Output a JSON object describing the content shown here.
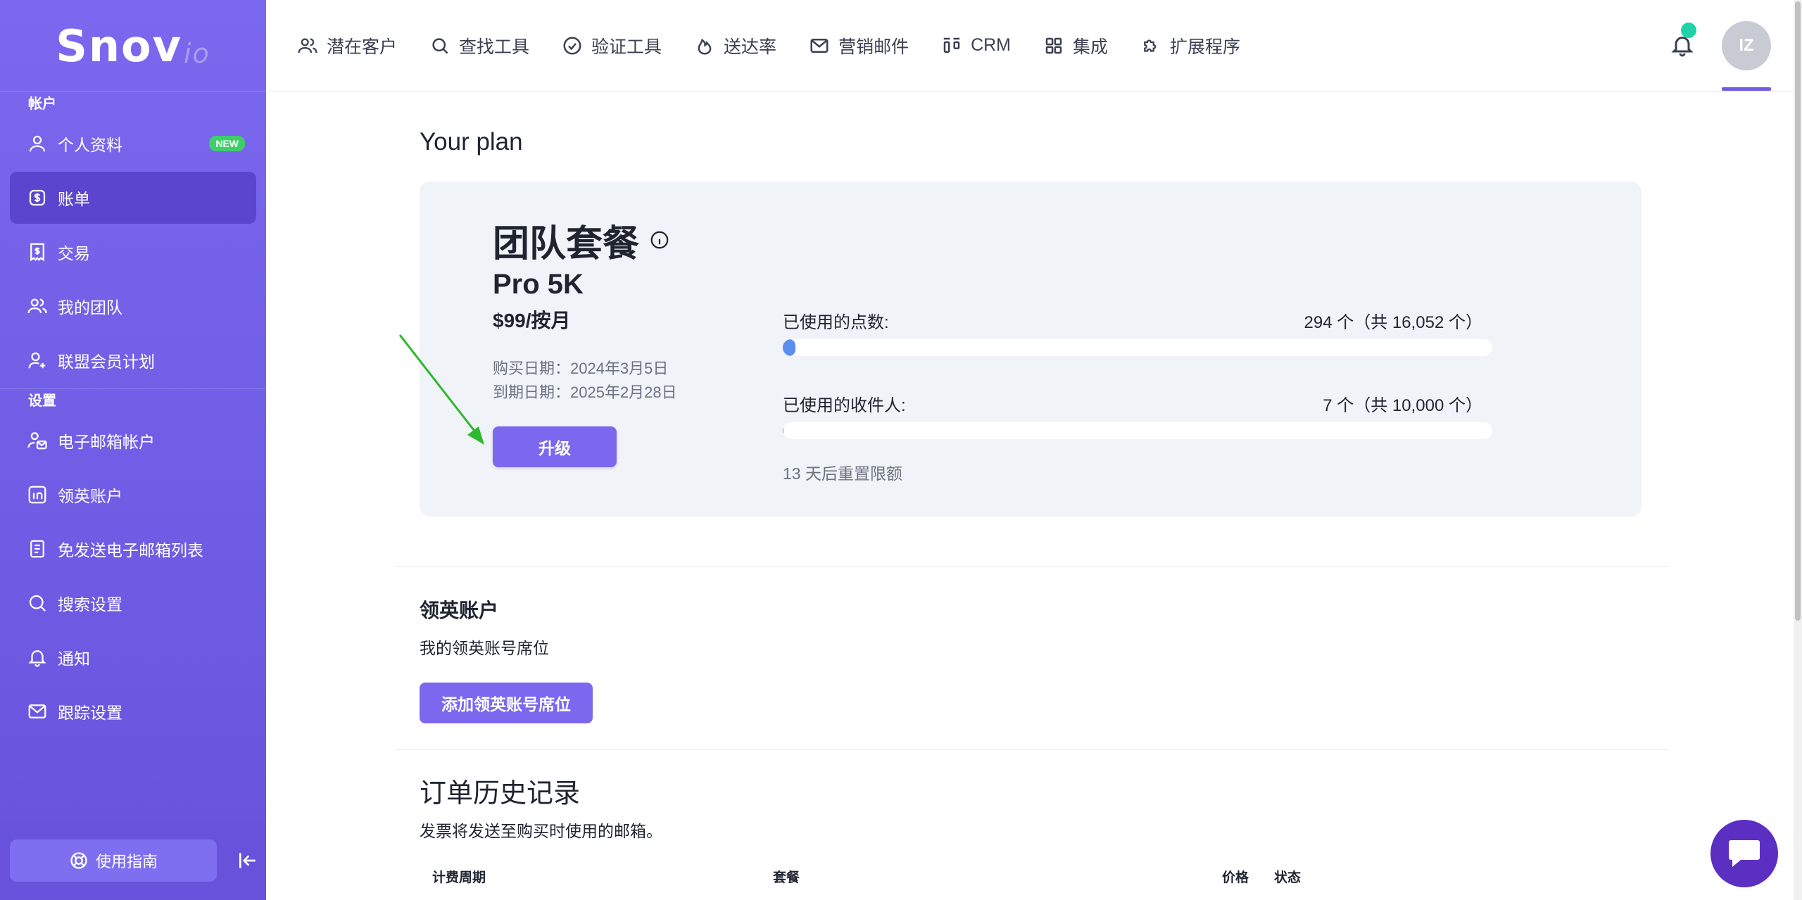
{
  "logo": {
    "main": "Snov",
    "suffix": "io"
  },
  "sidebar": {
    "section_account": "帐户",
    "section_settings": "设置",
    "items": [
      {
        "label": "个人资料",
        "badge": "NEW"
      },
      {
        "label": "账单"
      },
      {
        "label": "交易"
      },
      {
        "label": "我的团队"
      },
      {
        "label": "联盟会员计划"
      },
      {
        "label": "电子邮箱帐户"
      },
      {
        "label": "领英账户"
      },
      {
        "label": "免发送电子邮箱列表"
      },
      {
        "label": "搜索设置"
      },
      {
        "label": "通知"
      },
      {
        "label": "跟踪设置"
      }
    ],
    "guide_label": "使用指南"
  },
  "topnav": {
    "items": [
      "潜在客户",
      "查找工具",
      "验证工具",
      "送达率",
      "营销邮件",
      "CRM",
      "集成",
      "扩展程序"
    ],
    "avatar_initials": "IZ"
  },
  "plan": {
    "page_title": "Your plan",
    "name": "团队套餐",
    "tier": "Pro 5K",
    "price": "$99/按月",
    "purchase_date": "购买日期：2024年3月5日",
    "expiry_date": "到期日期：2025年2月28日",
    "upgrade_label": "升级",
    "credits_label": "已使用的点数:",
    "credits_value": "294 个（共 16,052 个）",
    "credits_used": 294,
    "credits_total": 16052,
    "recipients_label": "已使用的收件人:",
    "recipients_value": "7 个（共 10,000 个）",
    "recipients_used": 7,
    "recipients_total": 10000,
    "reset_text": "13 天后重置限额"
  },
  "linkedin": {
    "title": "领英账户",
    "subtitle": "我的领英账号席位",
    "add_label": "添加领英账号席位"
  },
  "orders": {
    "title": "订单历史记录",
    "subtitle": "发票将发送至购买时使用的邮箱。",
    "columns": [
      "计费周期",
      "套餐",
      "价格",
      "状态"
    ]
  },
  "colors": {
    "accent": "#7b68ee",
    "sidebar_active": "#5b45cf",
    "progress": "#5b8def",
    "notification_dot": "#1dd3a7"
  }
}
